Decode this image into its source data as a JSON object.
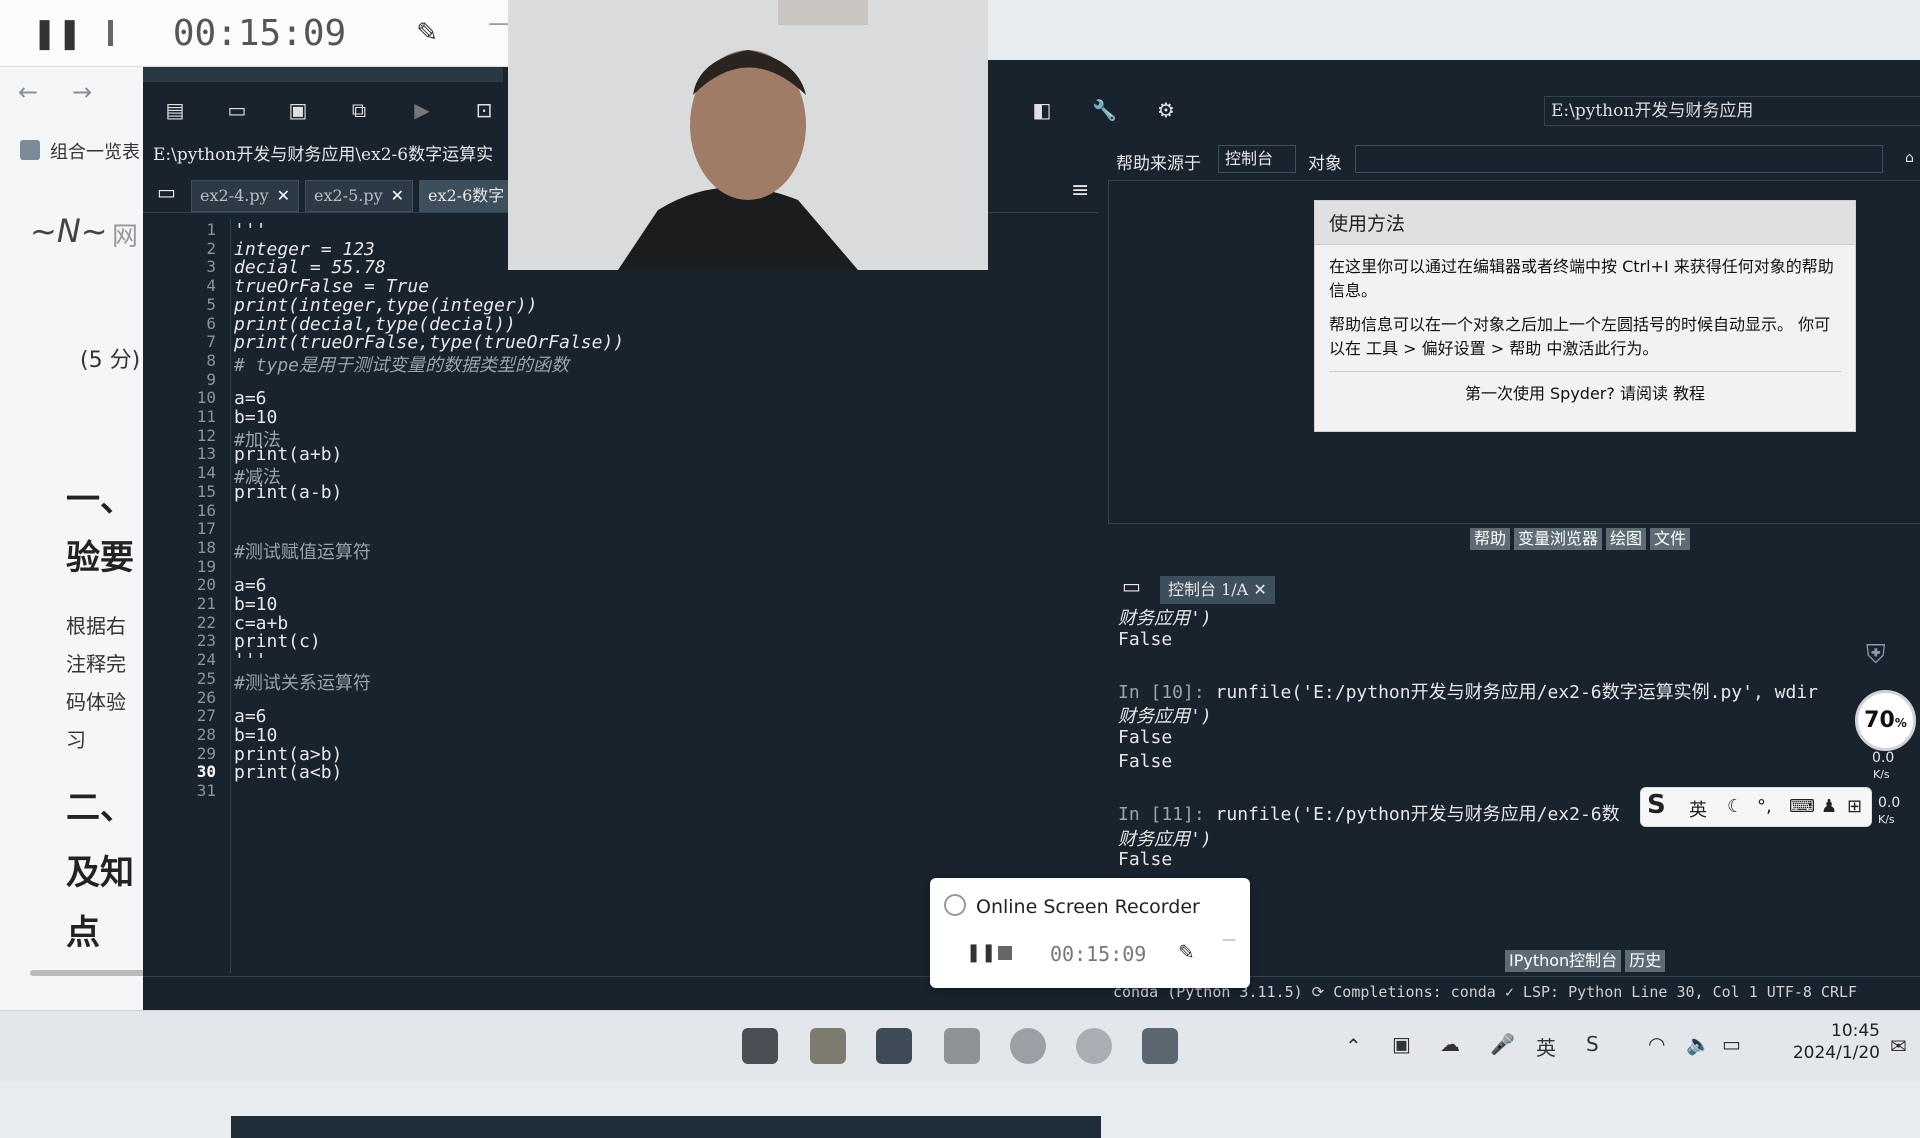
{
  "recorder_top": {
    "time": "00:15:09"
  },
  "browser": {
    "tab_title": "组合一览表",
    "logo_text": "网",
    "score_text": "(5 分)",
    "heading1": "一、",
    "heading1b": "验要",
    "para_lines": [
      "根据右",
      "注释完",
      "码体验",
      "习"
    ],
    "heading2": "二、",
    "heading2b": "及知",
    "heading2c": "点"
  },
  "toolbar": {
    "path": "E:\\python开发与财务应用"
  },
  "editor": {
    "path": "E:\\python开发与财务应用\\ex2-6数字运算实",
    "tabs": [
      "ex2-4.py",
      "ex2-5.py",
      "ex2-6数字"
    ],
    "lines": [
      {
        "n": "1",
        "text": "'''"
      },
      {
        "n": "2",
        "text": "integer = 123"
      },
      {
        "n": "3",
        "text": "decial = 55.78"
      },
      {
        "n": "4",
        "text": "trueOrFalse = True"
      },
      {
        "n": "5",
        "text": "print(integer,type(integer))"
      },
      {
        "n": "6",
        "text": "print(decial,type(decial))"
      },
      {
        "n": "7",
        "text": "print(trueOrFalse,type(trueOrFalse))"
      },
      {
        "n": "8",
        "text": "# type是用于测试变量的数据类型的函数",
        "comment": true
      },
      {
        "n": "9",
        "text": ""
      },
      {
        "n": "10",
        "text": "a=6"
      },
      {
        "n": "11",
        "text": "b=10"
      },
      {
        "n": "12",
        "text": "#加法",
        "comment": true
      },
      {
        "n": "13",
        "text": "print(a+b)"
      },
      {
        "n": "14",
        "text": "#减法",
        "comment": true
      },
      {
        "n": "15",
        "text": "print(a-b)"
      },
      {
        "n": "16",
        "text": ""
      },
      {
        "n": "17",
        "text": ""
      },
      {
        "n": "18",
        "text": "#测试赋值运算符",
        "comment": true
      },
      {
        "n": "19",
        "text": ""
      },
      {
        "n": "20",
        "text": "a=6"
      },
      {
        "n": "21",
        "text": "b=10"
      },
      {
        "n": "22",
        "text": "c=a+b"
      },
      {
        "n": "23",
        "text": "print(c)"
      },
      {
        "n": "24",
        "text": "'''"
      },
      {
        "n": "25",
        "text": "#测试关系运算符",
        "comment": true
      },
      {
        "n": "26",
        "text": ""
      },
      {
        "n": "27",
        "text": "a=6"
      },
      {
        "n": "28",
        "text": "b=10"
      },
      {
        "n": "29",
        "text": "print(a>b)"
      },
      {
        "n": "30",
        "text": "print(a<b)"
      },
      {
        "n": "31",
        "text": ""
      }
    ]
  },
  "help": {
    "source_label": "帮助来源于",
    "source_value": "控制台",
    "object_label": "对象",
    "usage_title": "使用方法",
    "usage_p1": "在这里你可以通过在编辑器或者终端中按 Ctrl+I 来获得任何对象的帮助信息。",
    "usage_p2": "帮助信息可以在一个对象之后加上一个左圆括号的时候自动显示。 你可以在 工具 > 偏好设置 > 帮助 中激活此行为。",
    "usage_foot": "第一次使用 Spyder? 请阅读 教程",
    "tabs": [
      "帮助",
      "变量浏览器",
      "绘图",
      "文件"
    ]
  },
  "console": {
    "tab": "控制台 1/A",
    "lines": [
      {
        "text": "财务应用')",
        "cls": "str"
      },
      {
        "text": "False"
      },
      {
        "text": ""
      },
      {
        "prompt": "In [10]:",
        "text": " runfile('E:/python开发与财务应用/ex2-6数字运算实例.py', wdir"
      },
      {
        "text": "财务应用')",
        "cls": "str"
      },
      {
        "text": "False"
      },
      {
        "text": "False"
      },
      {
        "text": ""
      },
      {
        "prompt": "In [11]:",
        "text": " runfile('E:/python开发与财务应用/ex2-6数"
      },
      {
        "text": "财务应用')",
        "cls": "str"
      },
      {
        "text": "False"
      }
    ],
    "bottom_tabs": [
      "IPython控制台",
      "历史"
    ]
  },
  "status": {
    "text": "conda (Python 3.11.5)  ⟳ Completions: conda  ✓ LSP: Python  Line 30, Col 1  UTF-8  CRLF"
  },
  "popup": {
    "title": "Online Screen Recorder",
    "time": "00:15:09"
  },
  "widgets": {
    "net_percent": "70",
    "net_unit": "%",
    "up_speed": "0.0",
    "down_speed": "0.0",
    "speed_unit": "K/s",
    "ime_label": "英"
  },
  "clock": {
    "time": "10:45",
    "date": "2024/1/20"
  }
}
